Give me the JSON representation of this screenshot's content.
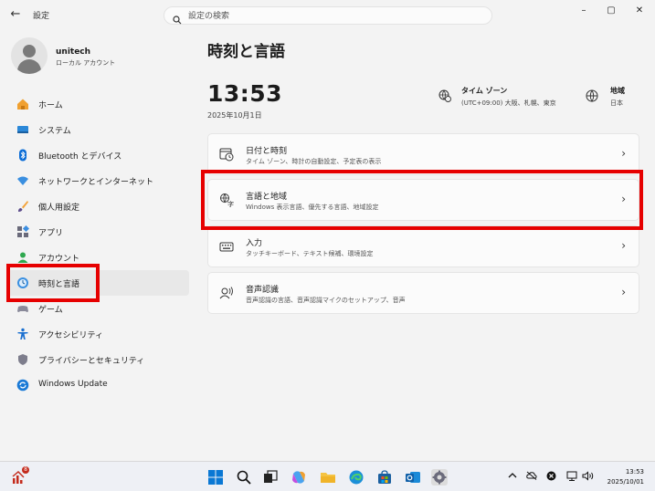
{
  "titlebar": {
    "back_glyph": "←",
    "app_title": "設定",
    "search_placeholder": "設定の検索",
    "minimize": "–",
    "maximize": "▢",
    "close": "✕"
  },
  "profile": {
    "name": "unitech",
    "account_type": "ローカル アカウント"
  },
  "sidebar": {
    "items": [
      {
        "label": "ホーム",
        "icon": "home-icon"
      },
      {
        "label": "システム",
        "icon": "system-icon"
      },
      {
        "label": "Bluetooth とデバイス",
        "icon": "bluetooth-icon"
      },
      {
        "label": "ネットワークとインターネット",
        "icon": "wifi-icon"
      },
      {
        "label": "個人用設定",
        "icon": "brush-icon"
      },
      {
        "label": "アプリ",
        "icon": "apps-icon"
      },
      {
        "label": "アカウント",
        "icon": "account-icon"
      },
      {
        "label": "時刻と言語",
        "icon": "time-language-icon",
        "active": true
      },
      {
        "label": "ゲーム",
        "icon": "gamepad-icon"
      },
      {
        "label": "アクセシビリティ",
        "icon": "accessibility-icon"
      },
      {
        "label": "プライバシーとセキュリティ",
        "icon": "shield-icon"
      },
      {
        "label": "Windows Update",
        "icon": "update-icon"
      }
    ]
  },
  "main": {
    "title": "時刻と言語",
    "clock": "13:53",
    "date": "2025年10月1日",
    "timezone": {
      "title": "タイム ゾーン",
      "value": "(UTC+09:00) 大阪、札幌、東京"
    },
    "region": {
      "title": "地域",
      "value": "日本"
    },
    "cards": [
      {
        "title": "日付と時刻",
        "desc": "タイム ゾーン、時計の自動設定、予定表の表示",
        "icon": "clock-calendar-icon"
      },
      {
        "title": "言語と地域",
        "desc": "Windows 表示言語、優先する言語、地域設定",
        "icon": "language-icon"
      },
      {
        "title": "入力",
        "desc": "タッチキーボード、テキスト候補、環境設定",
        "icon": "keyboard-icon"
      },
      {
        "title": "音声認識",
        "desc": "音声認識の言語、音声認識マイクのセットアップ、音声",
        "icon": "speech-icon"
      }
    ],
    "chevron": "›"
  },
  "taskbar": {
    "notification_count": "8",
    "time": "13:53",
    "date": "2025/10/01",
    "colors": {
      "accent": "#0078d4",
      "highlight": "#e60000"
    }
  }
}
